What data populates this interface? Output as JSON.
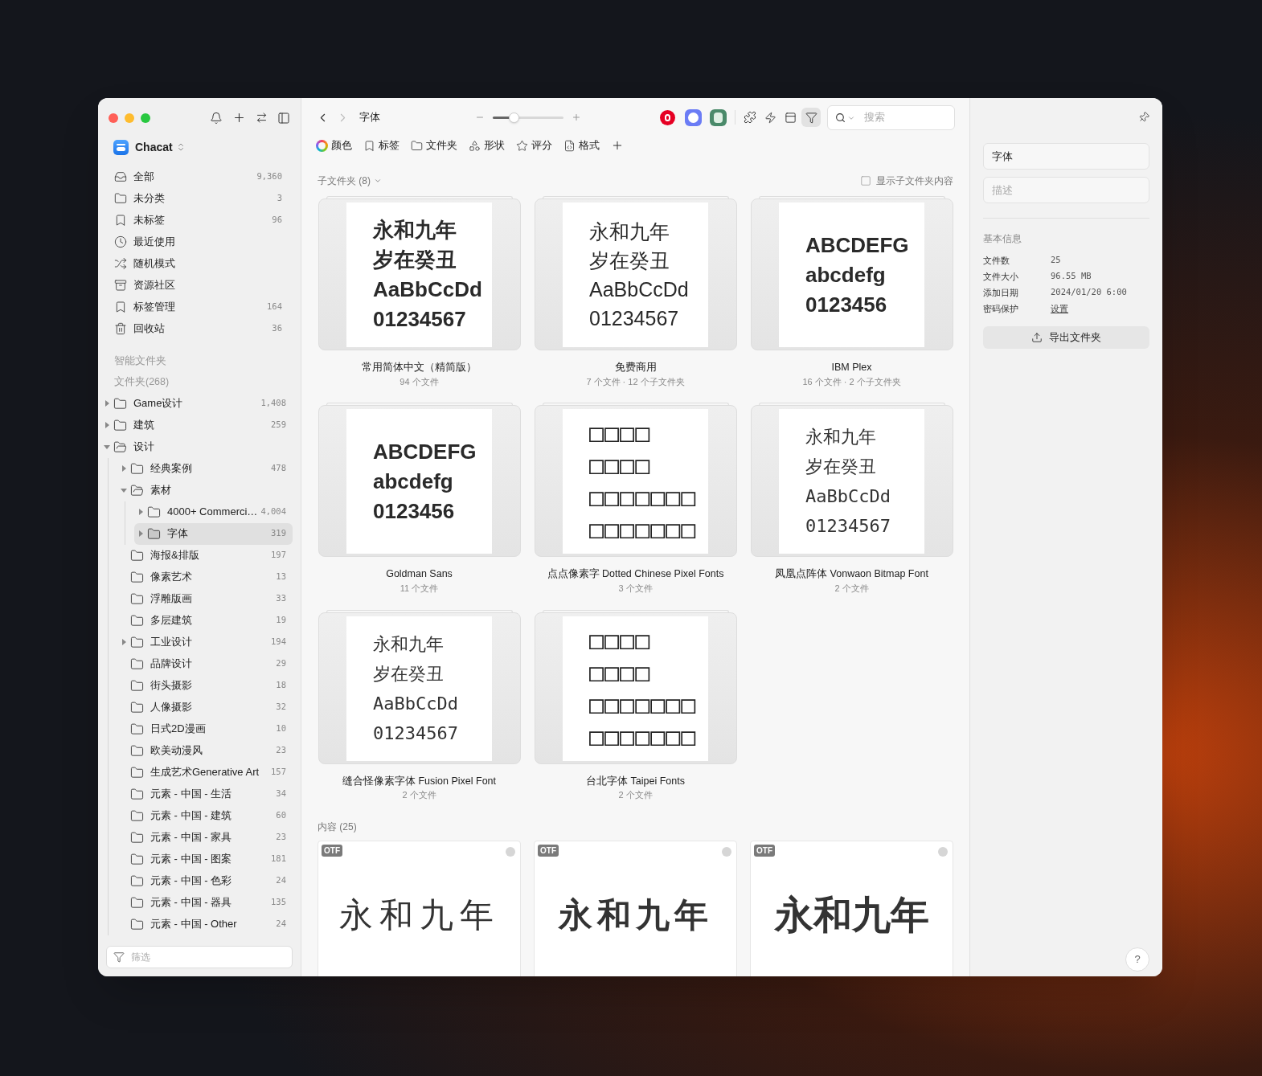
{
  "sidebar": {
    "library": "Chacat",
    "nav": [
      {
        "label": "全部",
        "count": "9,360"
      },
      {
        "label": "未分类",
        "count": "3"
      },
      {
        "label": "未标签",
        "count": "96"
      },
      {
        "label": "最近使用"
      },
      {
        "label": "随机模式"
      },
      {
        "label": "资源社区"
      },
      {
        "label": "标签管理",
        "count": "164"
      },
      {
        "label": "回收站",
        "count": "36"
      }
    ],
    "smart_folders": "智能文件夹",
    "folders_heading": "文件夹(268)",
    "folders": [
      {
        "name": "Game设计",
        "count": "1,408",
        "collapsible": true,
        "expanded": false,
        "selected": false
      },
      {
        "name": "建筑",
        "count": "259",
        "collapsible": true,
        "expanded": false,
        "selected": false
      },
      {
        "name": "设计",
        "collapsible": true,
        "expanded": true,
        "selected": false,
        "children": [
          {
            "name": "经典案例",
            "count": "478",
            "collapsible": true,
            "expanded": false,
            "selected": false
          },
          {
            "name": "素材",
            "collapsible": true,
            "expanded": true,
            "selected": false,
            "children": [
              {
                "name": "4000+ Commerci…",
                "count": "4,004",
                "collapsible": true,
                "expanded": false,
                "selected": false
              },
              {
                "name": "字体",
                "count": "319",
                "collapsible": true,
                "expanded": false,
                "selected": true
              }
            ]
          },
          {
            "name": "海报&排版",
            "count": "197",
            "collapsible": false,
            "expanded": false,
            "selected": false
          },
          {
            "name": "像素艺术",
            "count": "13",
            "collapsible": false,
            "expanded": false,
            "selected": false
          },
          {
            "name": "浮雕版画",
            "count": "33",
            "collapsible": false,
            "expanded": false,
            "selected": false
          },
          {
            "name": "多层建筑",
            "count": "19",
            "collapsible": false,
            "expanded": false,
            "selected": false
          },
          {
            "name": "工业设计",
            "count": "194",
            "collapsible": true,
            "expanded": false,
            "selected": false
          },
          {
            "name": "品牌设计",
            "count": "29",
            "collapsible": false,
            "expanded": false,
            "selected": false
          },
          {
            "name": "街头摄影",
            "count": "18",
            "collapsible": false,
            "expanded": false,
            "selected": false
          },
          {
            "name": "人像摄影",
            "count": "32",
            "collapsible": false,
            "expanded": false,
            "selected": false
          },
          {
            "name": "日式2D漫画",
            "count": "10",
            "collapsible": false,
            "expanded": false,
            "selected": false
          },
          {
            "name": "欧美动漫风",
            "count": "23",
            "collapsible": false,
            "expanded": false,
            "selected": false
          },
          {
            "name": "生成艺术Generative Art",
            "count": "157",
            "collapsible": false,
            "expanded": false,
            "selected": false
          },
          {
            "name": "元素 - 中国 - 生活",
            "count": "34",
            "collapsible": false,
            "expanded": false,
            "selected": false
          },
          {
            "name": "元素 - 中国 - 建筑",
            "count": "60",
            "collapsible": false,
            "expanded": false,
            "selected": false
          },
          {
            "name": "元素 - 中国 - 家具",
            "count": "23",
            "collapsible": false,
            "expanded": false,
            "selected": false
          },
          {
            "name": "元素 - 中国 - 图案",
            "count": "181",
            "collapsible": false,
            "expanded": false,
            "selected": false
          },
          {
            "name": "元素 - 中国 - 色彩",
            "count": "24",
            "collapsible": false,
            "expanded": false,
            "selected": false
          },
          {
            "name": "元素 - 中国 - 器具",
            "count": "135",
            "collapsible": false,
            "expanded": false,
            "selected": false
          },
          {
            "name": "元素 - 中国 - Other",
            "count": "24",
            "collapsible": false,
            "expanded": false,
            "selected": false
          }
        ]
      }
    ],
    "filter_placeholder": "筛选"
  },
  "toolbar": {
    "title": "字体",
    "zoom": {
      "level": 0.3
    },
    "filter_active": true,
    "search_placeholder": "搜索",
    "filters": [
      "颜色",
      "标签",
      "文件夹",
      "形状",
      "评分",
      "格式"
    ]
  },
  "subfolders": {
    "heading": "子文件夹 (8)",
    "show_contents": {
      "label": "显示子文件夹内容",
      "checked": false
    },
    "items": [
      {
        "name": "常用简体中文（精简版）",
        "meta": "94 个文件",
        "kind": "bold",
        "preview": [
          "永和九年",
          "岁在癸丑",
          "AaBbCcDd",
          "01234567"
        ]
      },
      {
        "name": "免费商用",
        "meta": "7 个文件 · 12 个子文件夹",
        "kind": "regular",
        "preview": [
          "永和九年",
          "岁在癸丑",
          "AaBbCcDd",
          "01234567"
        ]
      },
      {
        "name": "IBM Plex",
        "meta": "16 个文件 · 2 个子文件夹",
        "kind": "bold",
        "preview": [
          "ABCDEFG",
          "abcdefg",
          "0123456"
        ]
      },
      {
        "name": "Goldman Sans",
        "meta": "11 个文件",
        "kind": "bold",
        "preview": [
          "ABCDEFG",
          "abcdefg",
          "0123456"
        ]
      },
      {
        "name": "点点像素字 Dotted Chinese Pixel Fonts",
        "meta": "3 个文件",
        "kind": "tofu",
        "preview": [
          "□□□□",
          "□□□□",
          "□□□□□□□",
          "□□□□□□□"
        ]
      },
      {
        "name": "凤凰点阵体 Vonwaon Bitmap Font",
        "meta": "2 个文件",
        "kind": "pixel",
        "preview": [
          "永和九年",
          "岁在癸丑",
          "AaBbCcDd",
          "01234567"
        ]
      },
      {
        "name": "缝合怪像素字体 Fusion Pixel Font",
        "meta": "2 个文件",
        "kind": "pixel",
        "preview": [
          "永和九年",
          "岁在癸丑",
          "AaBbCcDd",
          "01234567"
        ]
      },
      {
        "name": "台北字体 Taipei Fonts",
        "meta": "2 个文件",
        "kind": "tofu",
        "preview": [
          "□□□□",
          "□□□□",
          "□□□□□□□",
          "□□□□□□□"
        ]
      }
    ]
  },
  "contents": {
    "heading": "内容 (25)",
    "items": [
      {
        "badge": "OTF",
        "preview": "永和九年",
        "kind": "light",
        "selected": false
      },
      {
        "badge": "OTF",
        "preview": "永和九年",
        "kind": "bold",
        "selected": false
      },
      {
        "badge": "OTF",
        "preview": "永和九年",
        "kind": "black",
        "selected": false
      }
    ]
  },
  "inspector": {
    "name": "字体",
    "description_placeholder": "描述",
    "section": "基本信息",
    "rows": [
      {
        "label": "文件数",
        "value": "25",
        "kind": "text"
      },
      {
        "label": "文件大小",
        "value": "96.55 MB",
        "kind": "text"
      },
      {
        "label": "添加日期",
        "value": "2024/01/20 6:00",
        "kind": "text"
      },
      {
        "label": "密码保护",
        "value": "设置",
        "kind": "link"
      }
    ],
    "export": "导出文件夹"
  },
  "help": "?"
}
